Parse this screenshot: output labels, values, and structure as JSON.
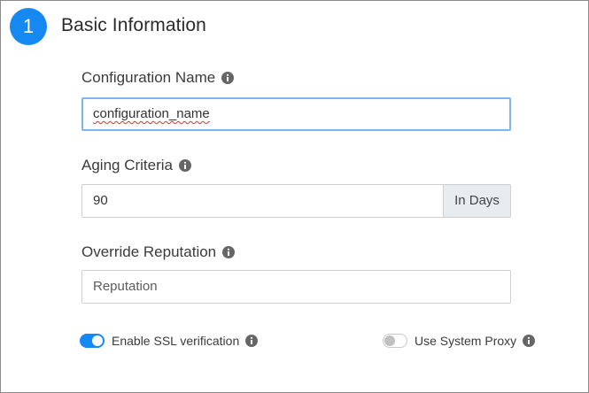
{
  "section": {
    "step_number": "1",
    "title": "Basic Information"
  },
  "fields": {
    "configuration_name": {
      "label": "Configuration Name",
      "value": "configuration_name"
    },
    "aging_criteria": {
      "label": "Aging Criteria",
      "value": "90",
      "addon": "In Days"
    },
    "override_reputation": {
      "label": "Override Reputation",
      "placeholder": "Reputation"
    }
  },
  "toggles": {
    "ssl": {
      "label": "Enable SSL verification",
      "enabled": true
    },
    "proxy": {
      "label": "Use System Proxy",
      "enabled": false
    }
  },
  "colors": {
    "accent": "#1688f2",
    "info_icon": "#666666",
    "focus_border": "#7fb5ea"
  },
  "icons": {
    "info": "info-icon"
  }
}
